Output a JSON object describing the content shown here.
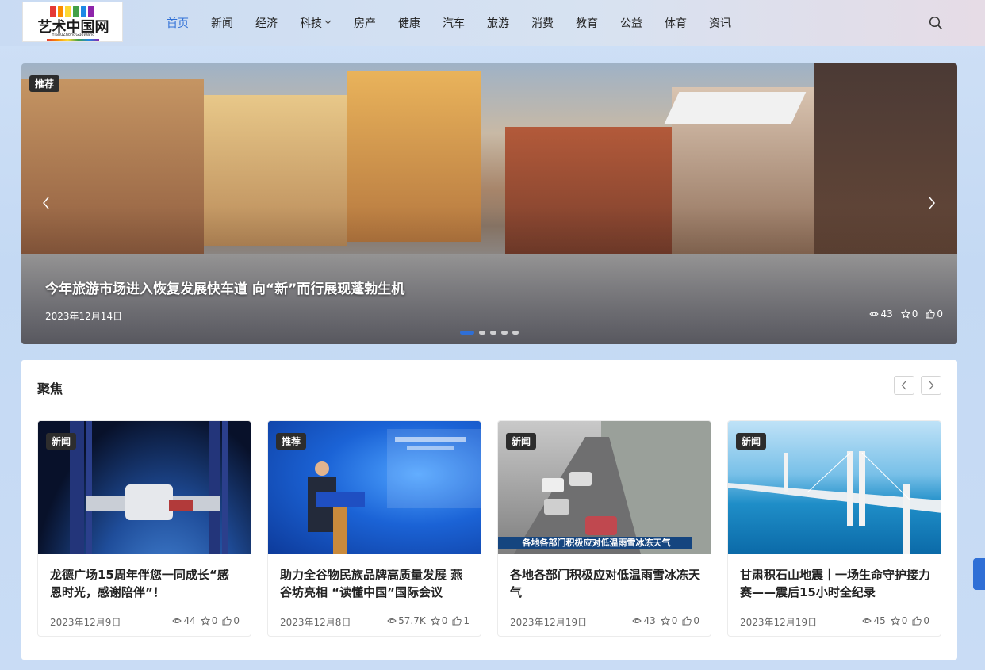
{
  "header": {
    "logo_text": "艺术中国网",
    "logo_sub": "YiShuZhongGuoWang",
    "logo_colors": [
      "#e53935",
      "#fb8c00",
      "#fdd835",
      "#43a047",
      "#1e88e5",
      "#8e24aa"
    ],
    "nav": [
      "首页",
      "新闻",
      "经济",
      "科技",
      "房产",
      "健康",
      "汽车",
      "旅游",
      "消费",
      "教育",
      "公益",
      "体育",
      "资讯"
    ],
    "active_nav": "首页",
    "accent": "#2f6fd6",
    "search_icon": "search-icon"
  },
  "hero": {
    "badge": "推荐",
    "title": "今年旅游市场进入恢复发展快车道 向“新”而行展现蓬勃生机",
    "date": "2023年12月14日",
    "views": "43",
    "favorites": "0",
    "likes": "0",
    "slide_count": 5,
    "active_slide": 1
  },
  "focus": {
    "title": "聚焦",
    "cards": [
      {
        "badge": "新闻",
        "title": "龙德广场15周年伴您一同成长“感恩时光，感谢陪伴”！",
        "date": "2023年12月9日",
        "views": "44",
        "favorites": "0",
        "likes": "0"
      },
      {
        "badge": "推荐",
        "title": "助力全谷物民族品牌高质量发展 燕谷坊亮相 “读懂中国”国际会议",
        "date": "2023年12月8日",
        "views": "57.7K",
        "favorites": "0",
        "likes": "1"
      },
      {
        "badge": "新闻",
        "title": "各地各部门积极应对低温雨雪冰冻天气",
        "date": "2023年12月19日",
        "views": "43",
        "favorites": "0",
        "likes": "0",
        "caption": "各地各部门积极应对低温雨雪冰冻天气"
      },
      {
        "badge": "新闻",
        "title": "甘肃积石山地震｜一场生命守护接力赛——震后15小时全纪录",
        "date": "2023年12月19日",
        "views": "45",
        "favorites": "0",
        "likes": "0"
      }
    ]
  }
}
